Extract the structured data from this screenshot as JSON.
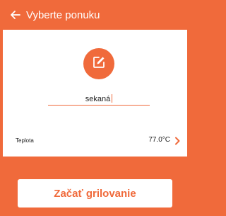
{
  "header": {
    "back_icon": "arrow-left-icon",
    "title": "Vyberte ponuku"
  },
  "editor": {
    "edit_icon": "edit-icon",
    "name_value": "sekaná"
  },
  "temperature": {
    "label": "Teplota",
    "value": "77.0°C",
    "chevron_icon": "chevron-right-icon"
  },
  "actions": {
    "start_label": "Začať grilovanie"
  },
  "colors": {
    "accent": "#f06a3b",
    "surface": "#ffffff"
  }
}
